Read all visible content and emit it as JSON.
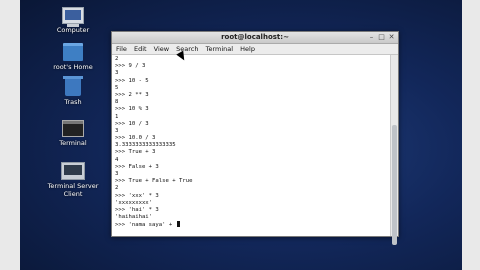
{
  "desktop": {
    "icons": [
      {
        "label": "Computer"
      },
      {
        "label": "root's Home"
      },
      {
        "label": "Trash"
      },
      {
        "label": "Terminal"
      },
      {
        "label": "Terminal Server\nClient"
      }
    ]
  },
  "window": {
    "title": "root@localhost:~",
    "menu": [
      "File",
      "Edit",
      "View",
      "Search",
      "Terminal",
      "Help"
    ],
    "lines": [
      "2",
      ">>> 9 / 3",
      "3",
      ">>> 10 - 5",
      "5",
      ">>> 2 ** 3",
      "8",
      ">>> 10 % 3",
      "1",
      ">>> 10 / 3",
      "3",
      ">>> 10.0 / 3",
      "3.3333333333333335",
      ">>> True + 3",
      "4",
      ">>> False + 3",
      "3",
      ">>> True + False + True",
      "2",
      ">>> 'xxx' * 3",
      "'xxxxxxxxx'",
      ">>> 'hai' * 3",
      "'haihaihai'",
      ">>> 'nama saya' + "
    ]
  }
}
